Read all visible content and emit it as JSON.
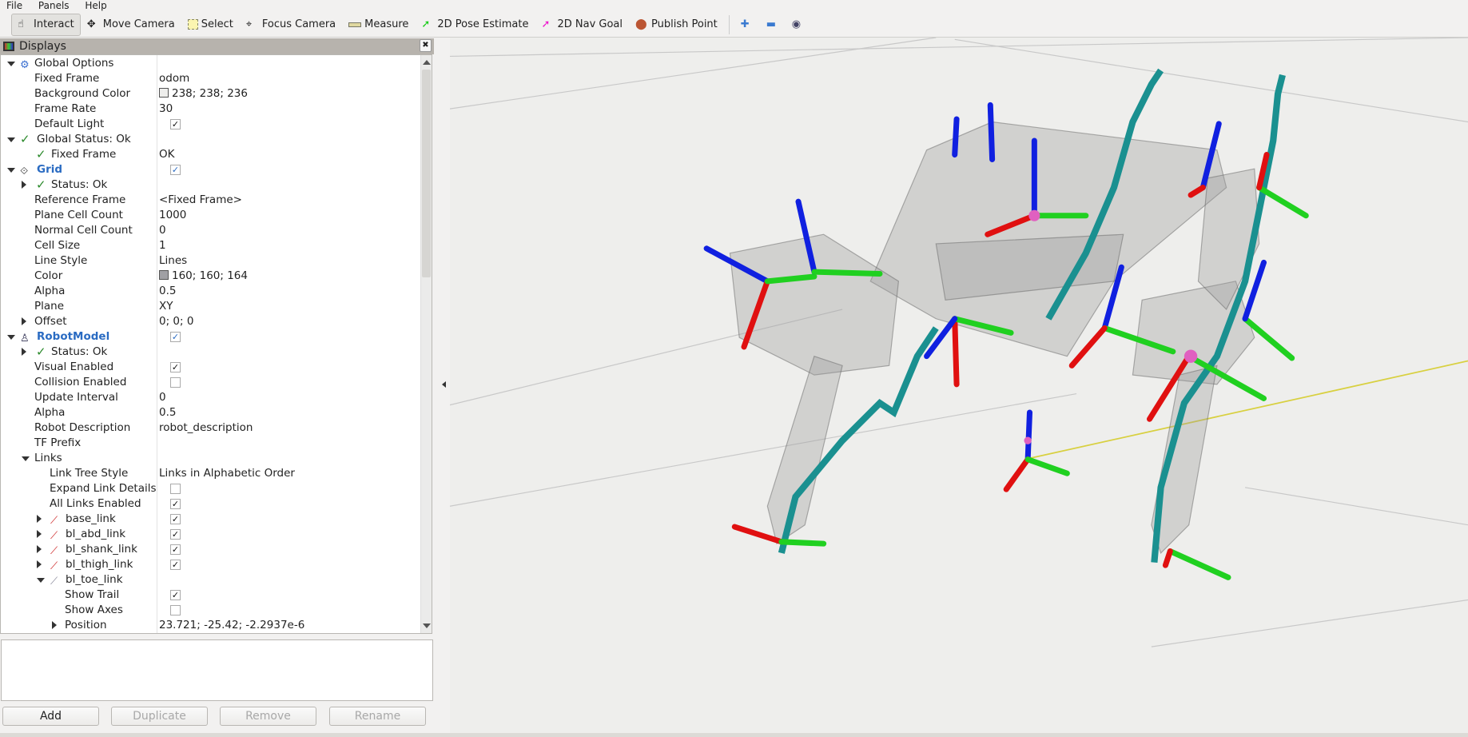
{
  "menu": [
    "File",
    "Panels",
    "Help"
  ],
  "toolbar": {
    "tools": [
      {
        "label": "Interact",
        "icon": "hand-pointer-icon",
        "active": true
      },
      {
        "label": "Move Camera",
        "icon": "move-camera-icon"
      },
      {
        "label": "Select",
        "icon": "select-box-icon"
      },
      {
        "label": "Focus Camera",
        "icon": "focus-crosshair-icon"
      },
      {
        "label": "Measure",
        "icon": "ruler-icon"
      },
      {
        "label": "2D Pose Estimate",
        "icon": "green-arrow-icon"
      },
      {
        "label": "2D Nav Goal",
        "icon": "pink-arrow-icon"
      },
      {
        "label": "Publish Point",
        "icon": "map-pin-icon"
      }
    ],
    "extra": [
      "plus-icon",
      "minus-icon",
      "eye-icon"
    ]
  },
  "displays": {
    "title": "Displays",
    "rows": [
      {
        "label": "Global Options",
        "value": ""
      },
      {
        "label": "Fixed Frame",
        "value": "odom"
      },
      {
        "label": "Background Color",
        "value": "238; 238; 236",
        "swatch": "#eeeeec"
      },
      {
        "label": "Frame Rate",
        "value": "30"
      },
      {
        "label": "Default Light",
        "checked": true
      },
      {
        "label": "Global Status: Ok",
        "value": ""
      },
      {
        "label": "Fixed Frame",
        "value": "OK"
      },
      {
        "label": "Grid",
        "checked": true
      },
      {
        "label": "Status: Ok",
        "value": ""
      },
      {
        "label": "Reference Frame",
        "value": "<Fixed Frame>"
      },
      {
        "label": "Plane Cell Count",
        "value": "1000"
      },
      {
        "label": "Normal Cell Count",
        "value": "0"
      },
      {
        "label": "Cell Size",
        "value": "1"
      },
      {
        "label": "Line Style",
        "value": "Lines"
      },
      {
        "label": "Color",
        "value": "160; 160; 164",
        "swatch": "#a0a0a4"
      },
      {
        "label": "Alpha",
        "value": "0.5"
      },
      {
        "label": "Plane",
        "value": "XY"
      },
      {
        "label": "Offset",
        "value": "0; 0; 0"
      },
      {
        "label": "RobotModel",
        "checked": true
      },
      {
        "label": "Status: Ok",
        "value": ""
      },
      {
        "label": "Visual Enabled",
        "checked": true
      },
      {
        "label": "Collision Enabled",
        "checked": false
      },
      {
        "label": "Update Interval",
        "value": "0"
      },
      {
        "label": "Alpha",
        "value": "0.5"
      },
      {
        "label": "Robot Description",
        "value": "robot_description"
      },
      {
        "label": "TF Prefix",
        "value": ""
      },
      {
        "label": "Links",
        "value": ""
      },
      {
        "label": "Link Tree Style",
        "value": "Links in Alphabetic Order"
      },
      {
        "label": "Expand Link Details",
        "checked": false
      },
      {
        "label": "All Links Enabled",
        "checked": true
      },
      {
        "label": "base_link",
        "checked": true
      },
      {
        "label": "bl_abd_link",
        "checked": true
      },
      {
        "label": "bl_shank_link",
        "checked": true
      },
      {
        "label": "bl_thigh_link",
        "checked": true
      },
      {
        "label": "bl_toe_link",
        "value": ""
      },
      {
        "label": "Show Trail",
        "checked": true
      },
      {
        "label": "Show Axes",
        "checked": false
      },
      {
        "label": "Position",
        "value": "23.721; -25.42; -2.2937e-6"
      }
    ]
  },
  "buttons": {
    "add": "Add",
    "duplicate": "Duplicate",
    "remove": "Remove",
    "rename": "Rename"
  },
  "colors": {
    "trail": "#1a9090",
    "axis_x": "#e01010",
    "axis_y": "#20d020",
    "axis_z": "#1020e0",
    "link_line": "#d8d040"
  }
}
